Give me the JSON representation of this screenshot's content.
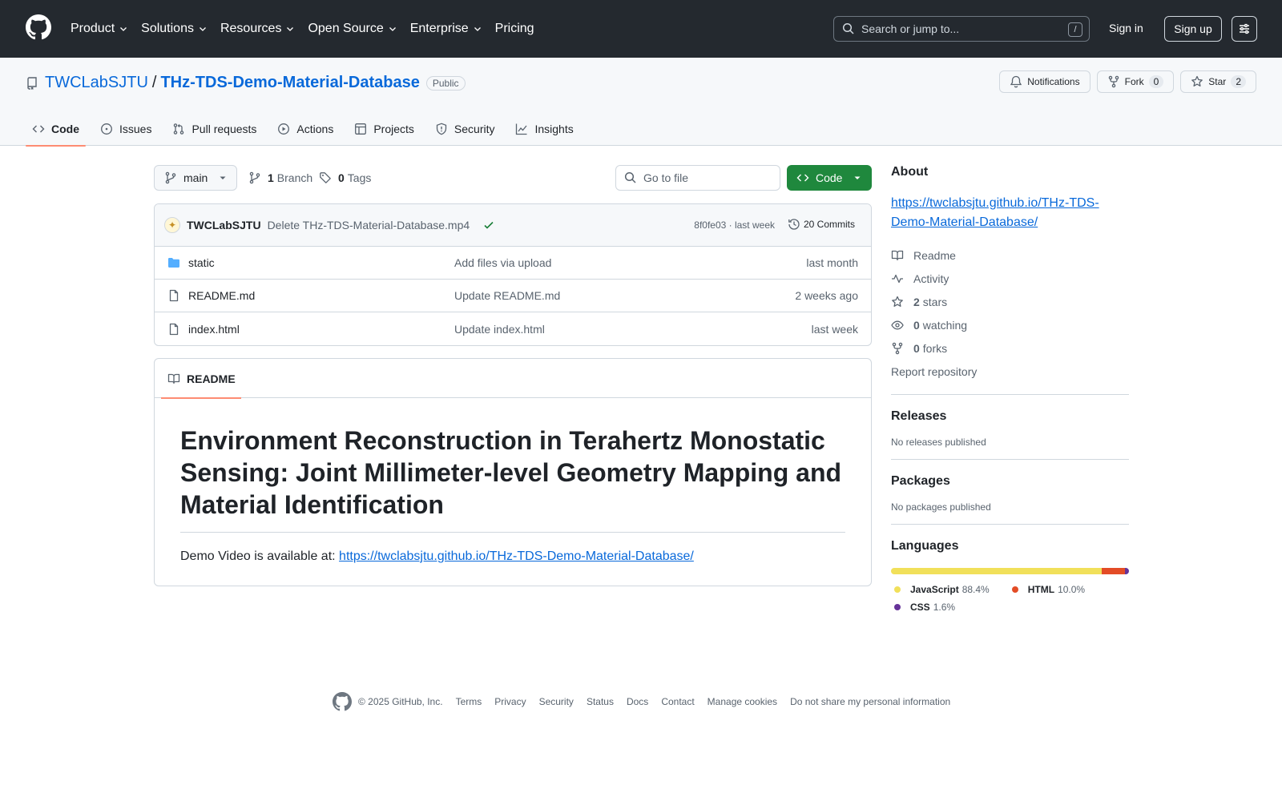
{
  "header": {
    "nav": [
      "Product",
      "Solutions",
      "Resources",
      "Open Source",
      "Enterprise",
      "Pricing"
    ],
    "search_placeholder": "Search or jump to...",
    "search_shortcut": "/",
    "sign_in": "Sign in",
    "sign_up": "Sign up"
  },
  "repo": {
    "owner": "TWCLabSJTU",
    "separator": "/",
    "name": "THz-TDS-Demo-Material-Database",
    "visibility": "Public",
    "notifications_label": "Notifications",
    "fork_label": "Fork",
    "fork_count": "0",
    "star_label": "Star",
    "star_count": "2"
  },
  "tabs": [
    {
      "label": "Code",
      "icon": "code-icon"
    },
    {
      "label": "Issues",
      "icon": "issue-icon"
    },
    {
      "label": "Pull requests",
      "icon": "pull-request-icon"
    },
    {
      "label": "Actions",
      "icon": "play-icon"
    },
    {
      "label": "Projects",
      "icon": "table-icon"
    },
    {
      "label": "Security",
      "icon": "shield-icon"
    },
    {
      "label": "Insights",
      "icon": "graph-icon"
    }
  ],
  "file_nav": {
    "branch": "main",
    "branch_count": "1",
    "branch_label": "Branch",
    "tag_count": "0",
    "tag_label": "Tags",
    "goto_placeholder": "Go to file",
    "code_button": "Code"
  },
  "commit": {
    "author": "TWCLabSJTU",
    "message": "Delete THz-TDS-Material-Database.mp4",
    "meta": "8f0fe03 · last week",
    "commits_label": "20 Commits"
  },
  "files": [
    {
      "name": "static",
      "type": "folder",
      "message": "Add files via upload",
      "date": "last month"
    },
    {
      "name": "README.md",
      "type": "file",
      "message": "Update README.md",
      "date": "2 weeks ago"
    },
    {
      "name": "index.html",
      "type": "file",
      "message": "Update index.html",
      "date": "last week"
    }
  ],
  "readme": {
    "tab_label": "README",
    "title": "Environment Reconstruction in Terahertz Monostatic Sensing: Joint Millimeter-level Geometry Mapping and Material Identification",
    "paragraph_prefix": "Demo Video is available at: ",
    "link": "https://twclabsjtu.github.io/THz-TDS-Demo-Material-Database/"
  },
  "about": {
    "heading": "About",
    "link": "https://twclabsjtu.github.io/THz-TDS-Demo-Material-Database/",
    "readme": "Readme",
    "activity": "Activity",
    "stars_count": "2",
    "stars_label": "stars",
    "watching_count": "0",
    "watching_label": "watching",
    "forks_count": "0",
    "forks_label": "forks",
    "report": "Report repository"
  },
  "releases": {
    "heading": "Releases",
    "empty": "No releases published"
  },
  "packages": {
    "heading": "Packages",
    "empty": "No packages published"
  },
  "languages": {
    "heading": "Languages",
    "items": [
      {
        "name": "JavaScript",
        "percent": "88.4%",
        "value": 88.4,
        "color": "#f1e05a"
      },
      {
        "name": "HTML",
        "percent": "10.0%",
        "value": 10.0,
        "color": "#e34c26"
      },
      {
        "name": "CSS",
        "percent": "1.6%",
        "value": 1.6,
        "color": "#663399"
      }
    ]
  },
  "footer": {
    "copyright": "© 2025 GitHub, Inc.",
    "links": [
      "Terms",
      "Privacy",
      "Security",
      "Status",
      "Docs",
      "Contact",
      "Manage cookies",
      "Do not share my personal information"
    ]
  }
}
